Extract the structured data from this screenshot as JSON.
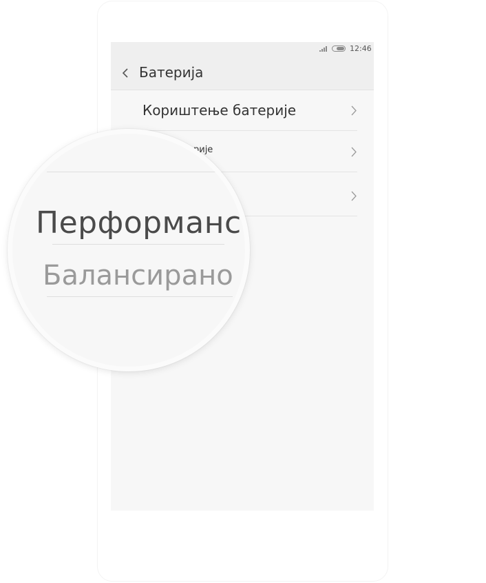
{
  "status_bar": {
    "time": "12:46"
  },
  "header": {
    "title": "Батерија"
  },
  "list": [
    {
      "label": "Кориштење батерије"
    },
    {
      "label": "ерије"
    },
    {
      "label": ""
    }
  ],
  "magnifier": {
    "title": "Перформансе",
    "subtitle": "Балансирано"
  }
}
